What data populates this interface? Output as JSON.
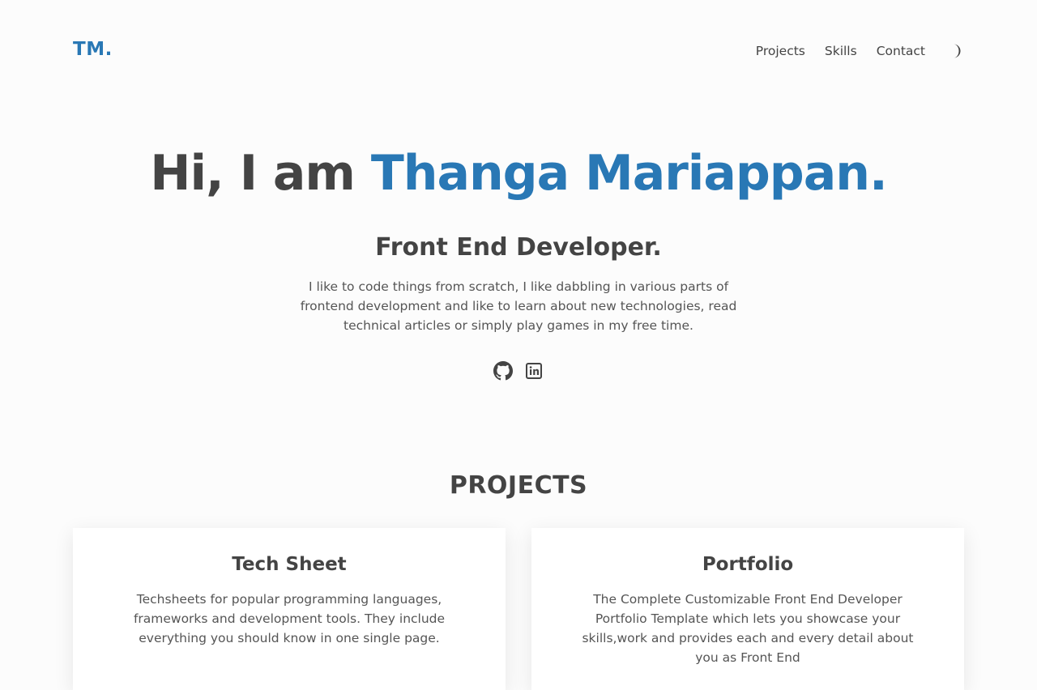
{
  "header": {
    "logo": "TM.",
    "nav": [
      {
        "label": "Projects"
      },
      {
        "label": "Skills"
      },
      {
        "label": "Contact"
      }
    ],
    "theme_toggle_icon": "moon-icon"
  },
  "hero": {
    "greeting": "Hi, I am ",
    "name": "Thanga Mariappan.",
    "role": "Front End Developer.",
    "description": "I like to code things from scratch, I like dabbling in various parts of frontend development and like to learn about new technologies, read technical articles or simply play games in my free time.",
    "social_icons": [
      "github-icon",
      "linkedin-icon"
    ]
  },
  "projects": {
    "heading": "PROJECTS",
    "items": [
      {
        "title": "Tech Sheet",
        "description": "Techsheets for popular programming languages, frameworks and development tools. They include everything you should know in one single page."
      },
      {
        "title": "Portfolio",
        "description": "The Complete Customizable Front End Developer Portfolio Template which lets you showcase your skills,work and provides each and every detail about you as Front End"
      }
    ]
  },
  "colors": {
    "accent": "#2978b5",
    "text": "#444444",
    "background": "#fcfcfc"
  }
}
